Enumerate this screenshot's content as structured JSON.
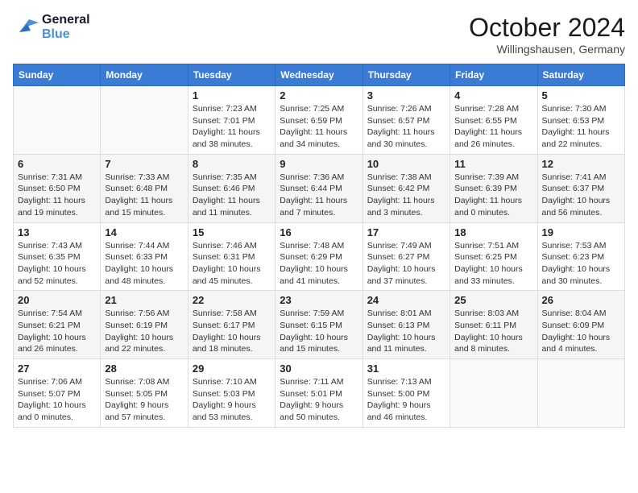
{
  "header": {
    "logo_line1": "General",
    "logo_line2": "Blue",
    "month_title": "October 2024",
    "subtitle": "Willingshausen, Germany"
  },
  "weekdays": [
    "Sunday",
    "Monday",
    "Tuesday",
    "Wednesday",
    "Thursday",
    "Friday",
    "Saturday"
  ],
  "weeks": [
    [
      {
        "day": "",
        "info": ""
      },
      {
        "day": "",
        "info": ""
      },
      {
        "day": "1",
        "info": "Sunrise: 7:23 AM\nSunset: 7:01 PM\nDaylight: 11 hours and 38 minutes."
      },
      {
        "day": "2",
        "info": "Sunrise: 7:25 AM\nSunset: 6:59 PM\nDaylight: 11 hours and 34 minutes."
      },
      {
        "day": "3",
        "info": "Sunrise: 7:26 AM\nSunset: 6:57 PM\nDaylight: 11 hours and 30 minutes."
      },
      {
        "day": "4",
        "info": "Sunrise: 7:28 AM\nSunset: 6:55 PM\nDaylight: 11 hours and 26 minutes."
      },
      {
        "day": "5",
        "info": "Sunrise: 7:30 AM\nSunset: 6:53 PM\nDaylight: 11 hours and 22 minutes."
      }
    ],
    [
      {
        "day": "6",
        "info": "Sunrise: 7:31 AM\nSunset: 6:50 PM\nDaylight: 11 hours and 19 minutes."
      },
      {
        "day": "7",
        "info": "Sunrise: 7:33 AM\nSunset: 6:48 PM\nDaylight: 11 hours and 15 minutes."
      },
      {
        "day": "8",
        "info": "Sunrise: 7:35 AM\nSunset: 6:46 PM\nDaylight: 11 hours and 11 minutes."
      },
      {
        "day": "9",
        "info": "Sunrise: 7:36 AM\nSunset: 6:44 PM\nDaylight: 11 hours and 7 minutes."
      },
      {
        "day": "10",
        "info": "Sunrise: 7:38 AM\nSunset: 6:42 PM\nDaylight: 11 hours and 3 minutes."
      },
      {
        "day": "11",
        "info": "Sunrise: 7:39 AM\nSunset: 6:39 PM\nDaylight: 11 hours and 0 minutes."
      },
      {
        "day": "12",
        "info": "Sunrise: 7:41 AM\nSunset: 6:37 PM\nDaylight: 10 hours and 56 minutes."
      }
    ],
    [
      {
        "day": "13",
        "info": "Sunrise: 7:43 AM\nSunset: 6:35 PM\nDaylight: 10 hours and 52 minutes."
      },
      {
        "day": "14",
        "info": "Sunrise: 7:44 AM\nSunset: 6:33 PM\nDaylight: 10 hours and 48 minutes."
      },
      {
        "day": "15",
        "info": "Sunrise: 7:46 AM\nSunset: 6:31 PM\nDaylight: 10 hours and 45 minutes."
      },
      {
        "day": "16",
        "info": "Sunrise: 7:48 AM\nSunset: 6:29 PM\nDaylight: 10 hours and 41 minutes."
      },
      {
        "day": "17",
        "info": "Sunrise: 7:49 AM\nSunset: 6:27 PM\nDaylight: 10 hours and 37 minutes."
      },
      {
        "day": "18",
        "info": "Sunrise: 7:51 AM\nSunset: 6:25 PM\nDaylight: 10 hours and 33 minutes."
      },
      {
        "day": "19",
        "info": "Sunrise: 7:53 AM\nSunset: 6:23 PM\nDaylight: 10 hours and 30 minutes."
      }
    ],
    [
      {
        "day": "20",
        "info": "Sunrise: 7:54 AM\nSunset: 6:21 PM\nDaylight: 10 hours and 26 minutes."
      },
      {
        "day": "21",
        "info": "Sunrise: 7:56 AM\nSunset: 6:19 PM\nDaylight: 10 hours and 22 minutes."
      },
      {
        "day": "22",
        "info": "Sunrise: 7:58 AM\nSunset: 6:17 PM\nDaylight: 10 hours and 18 minutes."
      },
      {
        "day": "23",
        "info": "Sunrise: 7:59 AM\nSunset: 6:15 PM\nDaylight: 10 hours and 15 minutes."
      },
      {
        "day": "24",
        "info": "Sunrise: 8:01 AM\nSunset: 6:13 PM\nDaylight: 10 hours and 11 minutes."
      },
      {
        "day": "25",
        "info": "Sunrise: 8:03 AM\nSunset: 6:11 PM\nDaylight: 10 hours and 8 minutes."
      },
      {
        "day": "26",
        "info": "Sunrise: 8:04 AM\nSunset: 6:09 PM\nDaylight: 10 hours and 4 minutes."
      }
    ],
    [
      {
        "day": "27",
        "info": "Sunrise: 7:06 AM\nSunset: 5:07 PM\nDaylight: 10 hours and 0 minutes."
      },
      {
        "day": "28",
        "info": "Sunrise: 7:08 AM\nSunset: 5:05 PM\nDaylight: 9 hours and 57 minutes."
      },
      {
        "day": "29",
        "info": "Sunrise: 7:10 AM\nSunset: 5:03 PM\nDaylight: 9 hours and 53 minutes."
      },
      {
        "day": "30",
        "info": "Sunrise: 7:11 AM\nSunset: 5:01 PM\nDaylight: 9 hours and 50 minutes."
      },
      {
        "day": "31",
        "info": "Sunrise: 7:13 AM\nSunset: 5:00 PM\nDaylight: 9 hours and 46 minutes."
      },
      {
        "day": "",
        "info": ""
      },
      {
        "day": "",
        "info": ""
      }
    ]
  ]
}
